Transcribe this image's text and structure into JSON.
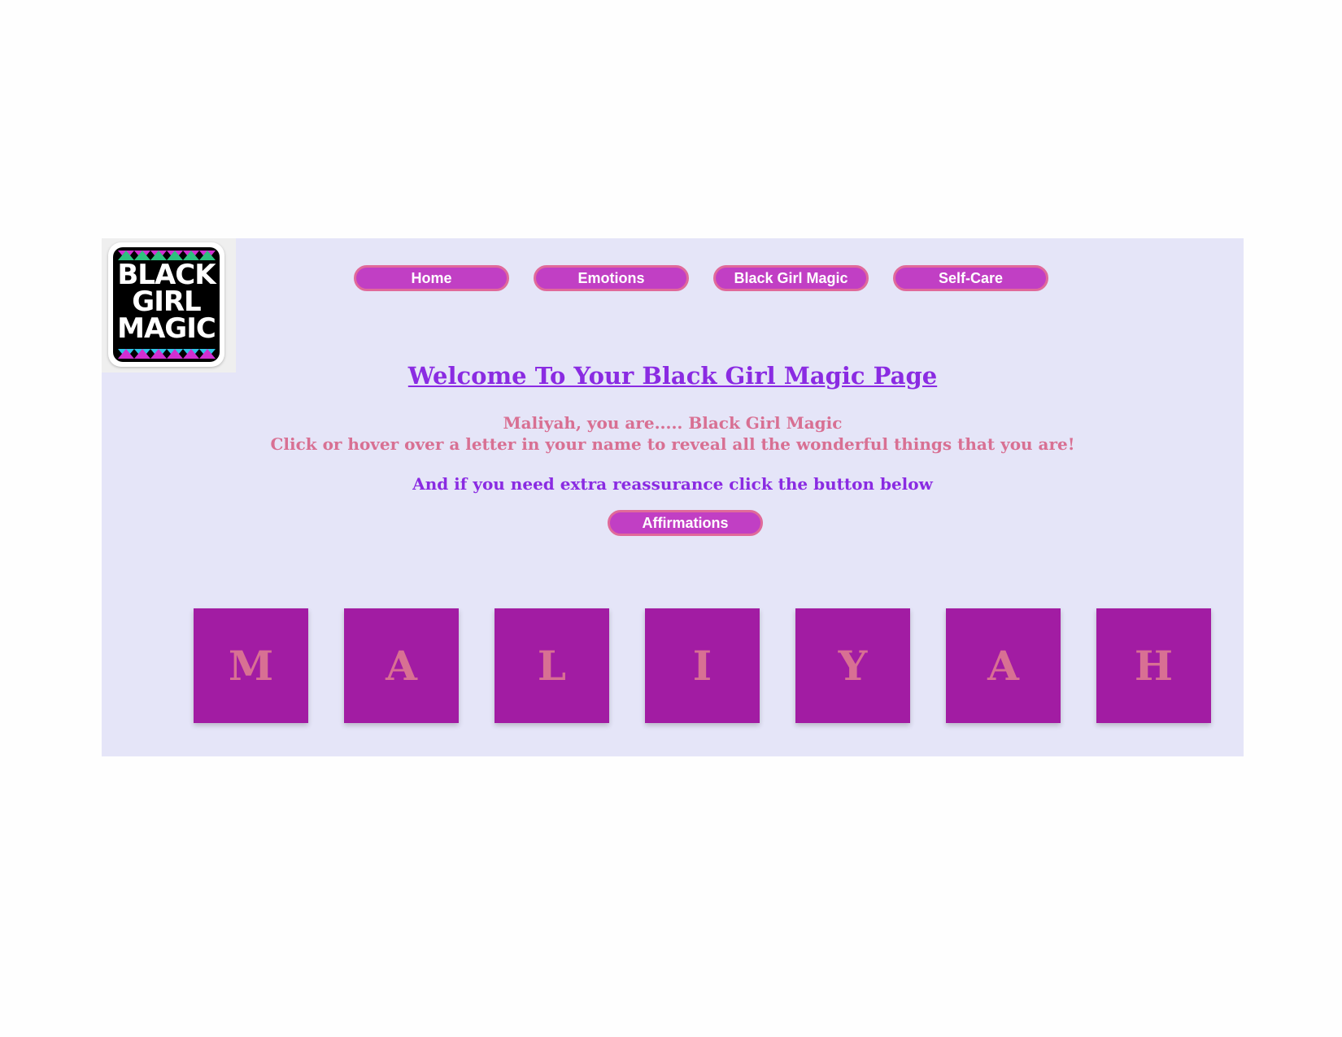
{
  "logo": {
    "lines": [
      "BLACK",
      "GIRL",
      "MAGIC"
    ],
    "colors": {
      "green": "#2ec27e",
      "magenta": "#d12fd1",
      "cyan": "#2fc4e8",
      "purple": "#8a6bd6"
    }
  },
  "nav": {
    "items": [
      {
        "label": "Home"
      },
      {
        "label": "Emotions"
      },
      {
        "label": "Black Girl Magic"
      },
      {
        "label": "Self-Care"
      }
    ]
  },
  "main": {
    "title": "Welcome To Your Black Girl Magic Page",
    "line1": "Maliyah, you are..... Black Girl Magic",
    "line2": "Click or hover over a letter in your name to reveal all the wonderful things that you are!",
    "line3": "And if you need extra reassurance click the button below",
    "affirm_label": "Affirmations"
  },
  "tiles": [
    "M",
    "A",
    "L",
    "I",
    "Y",
    "A",
    "H"
  ],
  "colors": {
    "page_bg": "#e5e5f8",
    "accent_purple": "#8a2be2",
    "pink_text": "#d87093",
    "button_fill": "#c13fc4",
    "tile_fill": "#a21ca3"
  }
}
